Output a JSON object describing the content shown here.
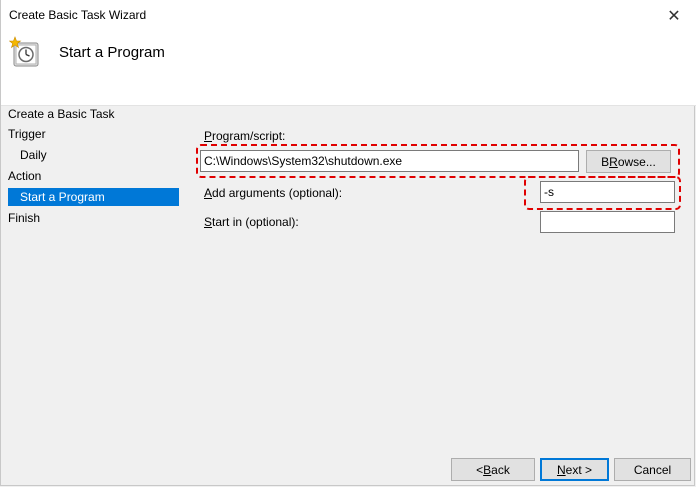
{
  "window": {
    "title": "Create Basic Task Wizard",
    "close_glyph": "✕"
  },
  "header": {
    "title": "Start a Program",
    "icon": "task-scheduler-clock-icon"
  },
  "nav": {
    "items": [
      {
        "label": "Create a Basic Task",
        "indent": false,
        "selected": false
      },
      {
        "label": "Trigger",
        "indent": false,
        "selected": false
      },
      {
        "label": "Daily",
        "indent": true,
        "selected": false
      },
      {
        "label": "Action",
        "indent": false,
        "selected": false
      },
      {
        "label": "Start a Program",
        "indent": true,
        "selected": true
      },
      {
        "label": "Finish",
        "indent": false,
        "selected": false
      }
    ]
  },
  "form": {
    "program_label_u": "P",
    "program_label_rest": "rogram/script:",
    "program_value": "C:\\Windows\\System32\\shutdown.exe",
    "browse_label_u": "R",
    "browse_label_pre": "B",
    "browse_label_rest": "owse...",
    "args_label_u": "A",
    "args_label_rest": "dd arguments (optional):",
    "args_value": "-s",
    "startin_label_u": "S",
    "startin_label_rest": "tart in (optional):",
    "startin_value": ""
  },
  "footer": {
    "back_pre": "< ",
    "back_u": "B",
    "back_rest": "ack",
    "next_u": "N",
    "next_rest": "ext >",
    "cancel_label": "Cancel"
  },
  "colors": {
    "selection": "#0078d7",
    "highlight_dash": "#e00000"
  }
}
